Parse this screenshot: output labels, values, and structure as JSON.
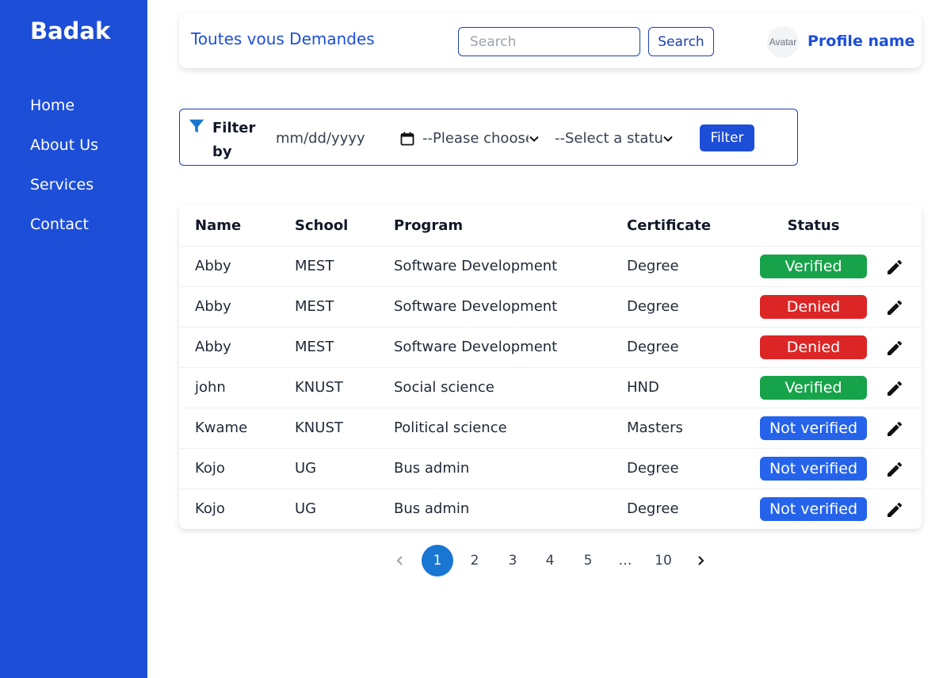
{
  "sidebar": {
    "brand": "Badak",
    "items": [
      {
        "label": "Home"
      },
      {
        "label": "About Us"
      },
      {
        "label": "Services"
      },
      {
        "label": "Contact"
      }
    ],
    "background": "#1d4ed8"
  },
  "header": {
    "title": "Toutes vous Demandes",
    "search_placeholder": "Search",
    "search_button": "Search",
    "avatar_alt": "Avatar",
    "profile_name": "Profile name"
  },
  "filter": {
    "label": "Filter by",
    "icon": "filter-icon",
    "date_placeholder": "mm/dd/yyyy",
    "select1": "--Please choose",
    "select2": "--Select a status",
    "button": "Filter"
  },
  "table": {
    "columns": [
      "Name",
      "School",
      "Program",
      "Certificate",
      "Status"
    ],
    "rows": [
      {
        "name": "Abby",
        "school": "MEST",
        "program": "Software Development",
        "certificate": "Degree",
        "status": "Verified"
      },
      {
        "name": "Abby",
        "school": "MEST",
        "program": "Software Development",
        "certificate": "Degree",
        "status": "Denied"
      },
      {
        "name": "Abby",
        "school": "MEST",
        "program": "Software Development",
        "certificate": "Degree",
        "status": "Denied"
      },
      {
        "name": "john",
        "school": "KNUST",
        "program": "Social science",
        "certificate": "HND",
        "status": "Verified"
      },
      {
        "name": "Kwame",
        "school": "KNUST",
        "program": "Political science",
        "certificate": "Masters",
        "status": "Not verified"
      },
      {
        "name": "Kojo",
        "school": "UG",
        "program": "Bus admin",
        "certificate": "Degree",
        "status": "Not verified"
      },
      {
        "name": "Kojo",
        "school": "UG",
        "program": "Bus admin",
        "certificate": "Degree",
        "status": "Not verified"
      }
    ],
    "status_colors": {
      "Verified": "#16a34a",
      "Denied": "#dc2626",
      "Not verified": "#2563eb"
    }
  },
  "pagination": {
    "pages": [
      "1",
      "2",
      "3",
      "4",
      "5",
      "…",
      "10"
    ],
    "current": "1"
  }
}
